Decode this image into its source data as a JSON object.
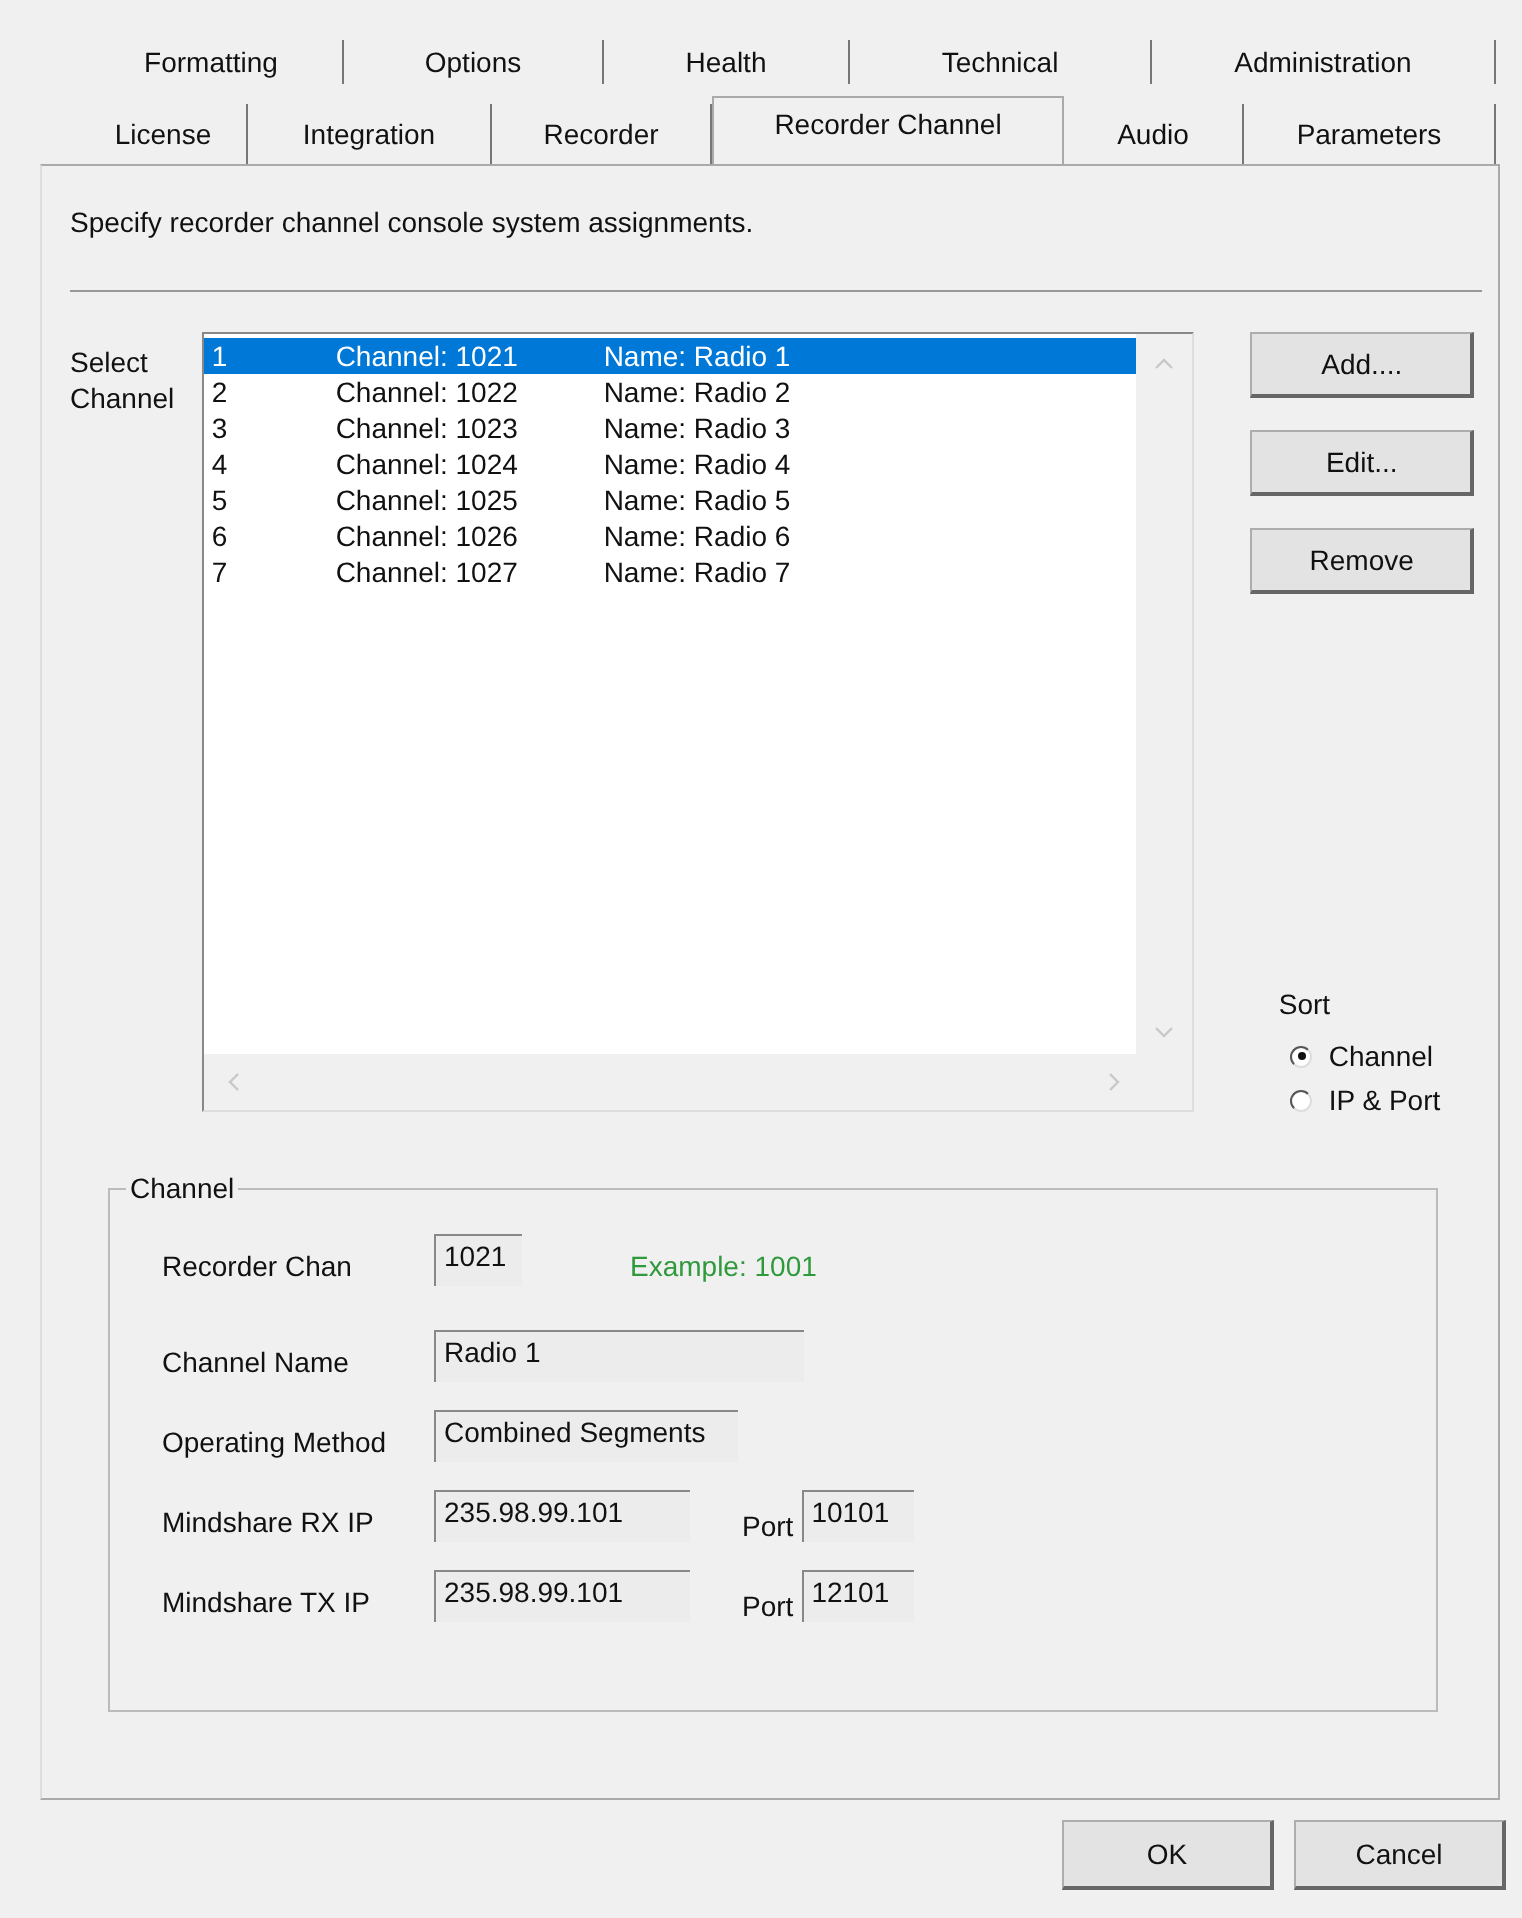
{
  "tab_rows": [
    [
      {
        "label": "Formatting",
        "selected": false
      },
      {
        "label": "Options",
        "selected": false
      },
      {
        "label": "Health",
        "selected": false
      },
      {
        "label": "Technical",
        "selected": false
      },
      {
        "label": "Administration",
        "selected": false
      }
    ],
    [
      {
        "label": "License",
        "selected": false
      },
      {
        "label": "Integration",
        "selected": false
      },
      {
        "label": "Recorder",
        "selected": false
      },
      {
        "label": "Recorder Channel",
        "selected": true
      },
      {
        "label": "Audio",
        "selected": false
      },
      {
        "label": "Parameters",
        "selected": false
      }
    ]
  ],
  "description": "Specify recorder channel console system assignments.",
  "channel_list": {
    "label": "Select Channel",
    "rows": [
      {
        "number": "1",
        "channel": "Channel: 1021",
        "name": "Name: Radio 1",
        "selected": true
      },
      {
        "number": "2",
        "channel": "Channel: 1022",
        "name": "Name: Radio 2",
        "selected": false
      },
      {
        "number": "3",
        "channel": "Channel: 1023",
        "name": "Name: Radio 3",
        "selected": false
      },
      {
        "number": "4",
        "channel": "Channel: 1024",
        "name": "Name: Radio 4",
        "selected": false
      },
      {
        "number": "5",
        "channel": "Channel: 1025",
        "name": "Name: Radio 5",
        "selected": false
      },
      {
        "number": "6",
        "channel": "Channel: 1026",
        "name": "Name: Radio 6",
        "selected": false
      },
      {
        "number": "7",
        "channel": "Channel: 1027",
        "name": "Name: Radio 7",
        "selected": false
      }
    ]
  },
  "side_buttons": [
    "Add....",
    "Edit...",
    "Remove"
  ],
  "sort": {
    "label": "Sort",
    "options": [
      {
        "label": "Channel",
        "selected": true
      },
      {
        "label": "IP & Port",
        "selected": false
      }
    ]
  },
  "channel_group": {
    "title": "Channel",
    "recorder_chan": {
      "label": "Recorder Chan",
      "value": "1021",
      "example": "Example: 1001"
    },
    "channel_name": {
      "label": "Channel Name",
      "value": "Radio 1"
    },
    "operating_method": {
      "label": "Operating Method",
      "value": "Combined Segments"
    },
    "rx": {
      "label": "Mindshare RX  IP",
      "ip": "235.98.99.101",
      "port_label": "Port",
      "port": "10101"
    },
    "tx": {
      "label": "Mindshare TX  IP",
      "ip": "235.98.99.101",
      "port_label": "Port",
      "port": "12101"
    }
  },
  "buttons": [
    "OK",
    "Cancel"
  ]
}
